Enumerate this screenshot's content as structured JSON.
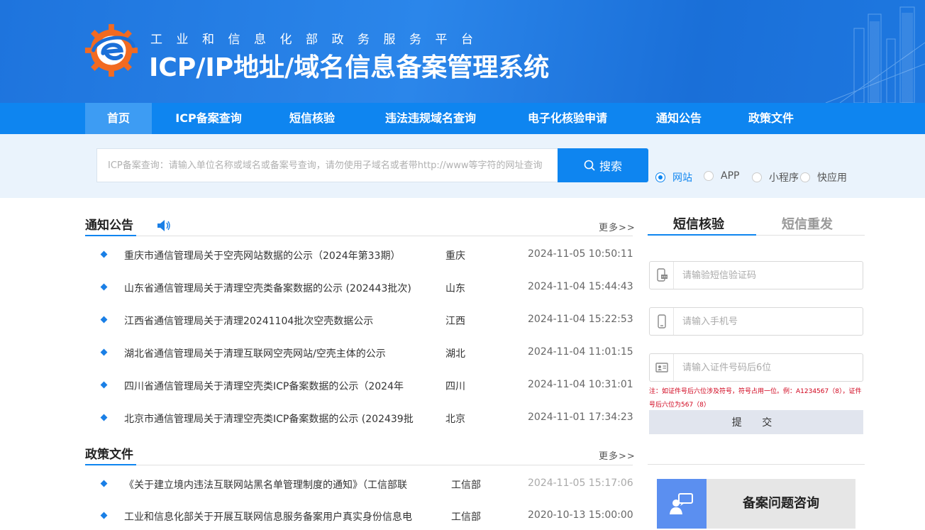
{
  "header": {
    "subtitle": "工业和信息化部政务服务平台",
    "title": "ICP/IP地址/域名信息备案管理系统"
  },
  "nav": {
    "items": [
      {
        "label": "首页",
        "active": true
      },
      {
        "label": "ICP备案查询"
      },
      {
        "label": "短信核验"
      },
      {
        "label": "违法违规域名查询"
      },
      {
        "label": "电子化核验申请"
      },
      {
        "label": "通知公告"
      },
      {
        "label": "政策文件"
      }
    ]
  },
  "search": {
    "placeholder": "ICP备案查询：请输入单位名称或域名或备案号查询，请勿使用子域名或者带http://www等字符的网址查询",
    "button_label": "搜索",
    "types": [
      {
        "label": "网站",
        "checked": true
      },
      {
        "label": "APP"
      },
      {
        "label": "小程序"
      },
      {
        "label": "快应用"
      }
    ]
  },
  "notices": {
    "title": "通知公告",
    "more": "更多>>",
    "items": [
      {
        "title": "重庆市通信管理局关于空壳网站数据的公示（2024年第33期）",
        "region": "重庆",
        "time": "2024-11-05 10:50:11"
      },
      {
        "title": "山东省通信管理局关于清理空壳类备案数据的公示 (202443批次)",
        "region": "山东",
        "time": "2024-11-04 15:44:43"
      },
      {
        "title": "江西省通信管理局关于清理20241104批次空壳数据公示",
        "region": "江西",
        "time": "2024-11-04 15:22:53"
      },
      {
        "title": "湖北省通信管理局关于清理互联网空壳网站/空壳主体的公示",
        "region": "湖北",
        "time": "2024-11-04 11:01:15"
      },
      {
        "title": "四川省通信管理局关于清理空壳类ICP备案数据的公示（2024年",
        "region": "四川",
        "time": "2024-11-04 10:31:01"
      },
      {
        "title": "北京市通信管理局关于清理空壳类ICP备案数据的公示 (202439批",
        "region": "北京",
        "time": "2024-11-01 17:34:23"
      }
    ]
  },
  "policies": {
    "title": "政策文件",
    "more": "更多>>",
    "items": [
      {
        "title": "《关于建立境内违法互联网站黑名单管理制度的通知》（工信部联",
        "region": "工信部",
        "time": "2024-11-05 15:17:06"
      },
      {
        "title": "工业和信息化部关于开展互联网信息服务备案用户真实身份信息电",
        "region": "工信部",
        "time": "2020-10-13 15:00:00"
      }
    ]
  },
  "sms_panel": {
    "tabs": [
      {
        "label": "短信核验",
        "active": true
      },
      {
        "label": "短信重发"
      }
    ],
    "code_placeholder": "请输验短信验证码",
    "phone_placeholder": "请输入手机号",
    "id_placeholder": "请输入证件号码后6位",
    "note": "注：如证件号后六位涉及符号，符号占用一位。例：A1234567（8），证件号后六位为567（8）",
    "submit_label": "提 交"
  },
  "consult": {
    "label": "备案问题咨询"
  },
  "colors": {
    "primary": "#0e85f0",
    "nav_active": "#3d9cf3",
    "header_start": "#1e74dd",
    "search_band": "#eaf3fc",
    "warning": "#d0021b",
    "consult_icon_bg": "#5b8ff0"
  },
  "icons": {
    "search": "search-icon",
    "speaker": "speaker-icon",
    "sms_code": "sms-code-icon",
    "phone": "mobile-phone-icon",
    "id_card": "id-card-icon",
    "consult": "consult-chat-icon"
  }
}
